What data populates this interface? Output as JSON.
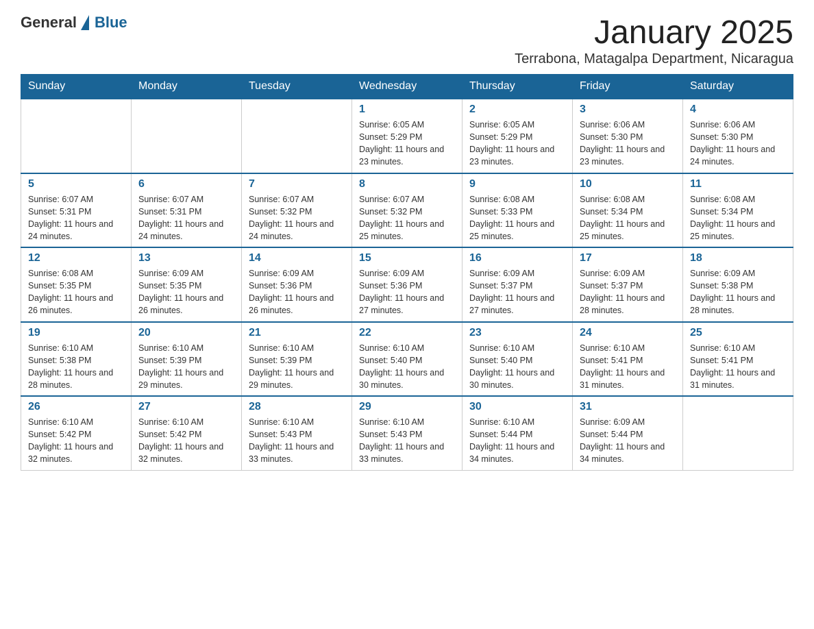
{
  "logo": {
    "text_general": "General",
    "text_blue": "Blue"
  },
  "calendar": {
    "title": "January 2025",
    "subtitle": "Terrabona, Matagalpa Department, Nicaragua",
    "days_of_week": [
      "Sunday",
      "Monday",
      "Tuesday",
      "Wednesday",
      "Thursday",
      "Friday",
      "Saturday"
    ],
    "weeks": [
      [
        {
          "day": "",
          "info": ""
        },
        {
          "day": "",
          "info": ""
        },
        {
          "day": "",
          "info": ""
        },
        {
          "day": "1",
          "info": "Sunrise: 6:05 AM\nSunset: 5:29 PM\nDaylight: 11 hours and 23 minutes."
        },
        {
          "day": "2",
          "info": "Sunrise: 6:05 AM\nSunset: 5:29 PM\nDaylight: 11 hours and 23 minutes."
        },
        {
          "day": "3",
          "info": "Sunrise: 6:06 AM\nSunset: 5:30 PM\nDaylight: 11 hours and 23 minutes."
        },
        {
          "day": "4",
          "info": "Sunrise: 6:06 AM\nSunset: 5:30 PM\nDaylight: 11 hours and 24 minutes."
        }
      ],
      [
        {
          "day": "5",
          "info": "Sunrise: 6:07 AM\nSunset: 5:31 PM\nDaylight: 11 hours and 24 minutes."
        },
        {
          "day": "6",
          "info": "Sunrise: 6:07 AM\nSunset: 5:31 PM\nDaylight: 11 hours and 24 minutes."
        },
        {
          "day": "7",
          "info": "Sunrise: 6:07 AM\nSunset: 5:32 PM\nDaylight: 11 hours and 24 minutes."
        },
        {
          "day": "8",
          "info": "Sunrise: 6:07 AM\nSunset: 5:32 PM\nDaylight: 11 hours and 25 minutes."
        },
        {
          "day": "9",
          "info": "Sunrise: 6:08 AM\nSunset: 5:33 PM\nDaylight: 11 hours and 25 minutes."
        },
        {
          "day": "10",
          "info": "Sunrise: 6:08 AM\nSunset: 5:34 PM\nDaylight: 11 hours and 25 minutes."
        },
        {
          "day": "11",
          "info": "Sunrise: 6:08 AM\nSunset: 5:34 PM\nDaylight: 11 hours and 25 minutes."
        }
      ],
      [
        {
          "day": "12",
          "info": "Sunrise: 6:08 AM\nSunset: 5:35 PM\nDaylight: 11 hours and 26 minutes."
        },
        {
          "day": "13",
          "info": "Sunrise: 6:09 AM\nSunset: 5:35 PM\nDaylight: 11 hours and 26 minutes."
        },
        {
          "day": "14",
          "info": "Sunrise: 6:09 AM\nSunset: 5:36 PM\nDaylight: 11 hours and 26 minutes."
        },
        {
          "day": "15",
          "info": "Sunrise: 6:09 AM\nSunset: 5:36 PM\nDaylight: 11 hours and 27 minutes."
        },
        {
          "day": "16",
          "info": "Sunrise: 6:09 AM\nSunset: 5:37 PM\nDaylight: 11 hours and 27 minutes."
        },
        {
          "day": "17",
          "info": "Sunrise: 6:09 AM\nSunset: 5:37 PM\nDaylight: 11 hours and 28 minutes."
        },
        {
          "day": "18",
          "info": "Sunrise: 6:09 AM\nSunset: 5:38 PM\nDaylight: 11 hours and 28 minutes."
        }
      ],
      [
        {
          "day": "19",
          "info": "Sunrise: 6:10 AM\nSunset: 5:38 PM\nDaylight: 11 hours and 28 minutes."
        },
        {
          "day": "20",
          "info": "Sunrise: 6:10 AM\nSunset: 5:39 PM\nDaylight: 11 hours and 29 minutes."
        },
        {
          "day": "21",
          "info": "Sunrise: 6:10 AM\nSunset: 5:39 PM\nDaylight: 11 hours and 29 minutes."
        },
        {
          "day": "22",
          "info": "Sunrise: 6:10 AM\nSunset: 5:40 PM\nDaylight: 11 hours and 30 minutes."
        },
        {
          "day": "23",
          "info": "Sunrise: 6:10 AM\nSunset: 5:40 PM\nDaylight: 11 hours and 30 minutes."
        },
        {
          "day": "24",
          "info": "Sunrise: 6:10 AM\nSunset: 5:41 PM\nDaylight: 11 hours and 31 minutes."
        },
        {
          "day": "25",
          "info": "Sunrise: 6:10 AM\nSunset: 5:41 PM\nDaylight: 11 hours and 31 minutes."
        }
      ],
      [
        {
          "day": "26",
          "info": "Sunrise: 6:10 AM\nSunset: 5:42 PM\nDaylight: 11 hours and 32 minutes."
        },
        {
          "day": "27",
          "info": "Sunrise: 6:10 AM\nSunset: 5:42 PM\nDaylight: 11 hours and 32 minutes."
        },
        {
          "day": "28",
          "info": "Sunrise: 6:10 AM\nSunset: 5:43 PM\nDaylight: 11 hours and 33 minutes."
        },
        {
          "day": "29",
          "info": "Sunrise: 6:10 AM\nSunset: 5:43 PM\nDaylight: 11 hours and 33 minutes."
        },
        {
          "day": "30",
          "info": "Sunrise: 6:10 AM\nSunset: 5:44 PM\nDaylight: 11 hours and 34 minutes."
        },
        {
          "day": "31",
          "info": "Sunrise: 6:09 AM\nSunset: 5:44 PM\nDaylight: 11 hours and 34 minutes."
        },
        {
          "day": "",
          "info": ""
        }
      ]
    ]
  }
}
